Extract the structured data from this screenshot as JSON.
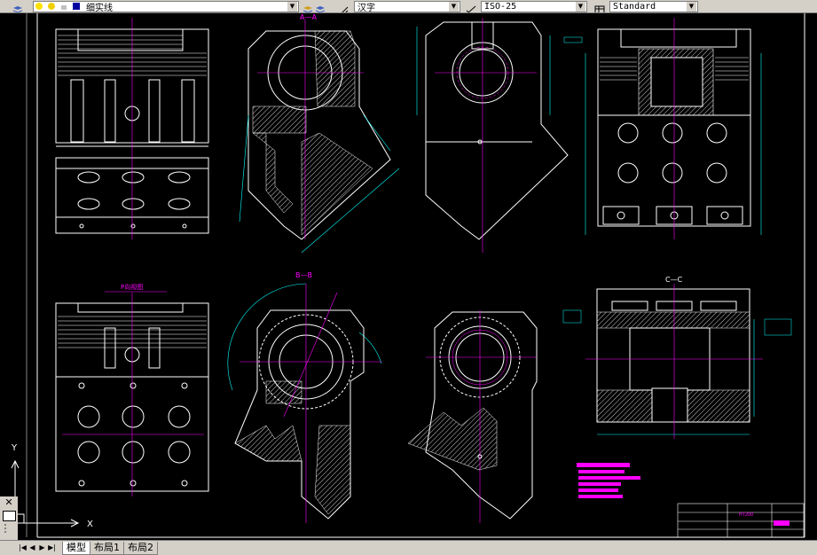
{
  "toolbar": {
    "layer_value": "细实线",
    "textstyle_value": "汉字",
    "dimstyle_value": "ISO-25",
    "tablestyle_value": "Standard"
  },
  "drawing": {
    "section_aa": "A—A",
    "section_bb": "B—B",
    "section_cc": "C—C",
    "label_p": "P向视图",
    "title_block_text": "HT200"
  },
  "ucs": {
    "y_label": "Y",
    "x_label": "X"
  },
  "tabs": [
    "模型",
    "布局1",
    "布局2"
  ],
  "colors": {
    "canvas": "#000000",
    "line": "#ffffff",
    "center": "#ff00ff",
    "dim": "#00ffff",
    "panel": "#d4d0c8"
  }
}
